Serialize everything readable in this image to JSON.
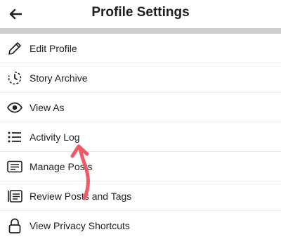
{
  "header": {
    "title": "Profile Settings",
    "back_icon": "arrow-left-icon"
  },
  "menu": {
    "items": [
      {
        "label": "Edit Profile",
        "icon": "pencil-icon"
      },
      {
        "label": "Story Archive",
        "icon": "clock-history-icon"
      },
      {
        "label": "View As",
        "icon": "eye-icon"
      },
      {
        "label": "Activity Log",
        "icon": "list-icon"
      },
      {
        "label": "Manage Posts",
        "icon": "posts-icon"
      },
      {
        "label": "Review Posts and Tags",
        "icon": "tag-review-icon"
      },
      {
        "label": "View Privacy Shortcuts",
        "icon": "lock-icon"
      }
    ]
  },
  "colors": {
    "divider_band": "#cdcdd2",
    "annotation_arrow": "#f05a66"
  }
}
